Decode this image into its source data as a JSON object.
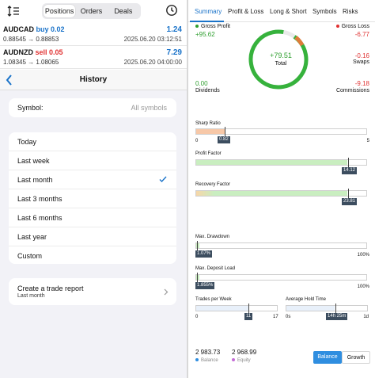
{
  "left": {
    "segments": [
      "Positions",
      "Orders",
      "Deals"
    ],
    "positions": [
      {
        "symbol": "AUDCAD",
        "side": "buy 0.02",
        "side_color": "#1a73c9",
        "prices": "0.88545 → 0.88853",
        "pl": "1.24",
        "time": "2025.06.20 03:12:51"
      },
      {
        "symbol": "AUDNZD",
        "side": "sell 0.05",
        "side_color": "#e03131",
        "prices": "1.08345 → 1.08065",
        "pl": "7.29",
        "time": "2025.06.20 04:00:00"
      }
    ],
    "history": {
      "title": "History",
      "symbol_label": "Symbol:",
      "symbol_value": "All symbols",
      "periods": [
        "Today",
        "Last week",
        "Last month",
        "Last 3 months",
        "Last 6 months",
        "Last year",
        "Custom"
      ],
      "selected_period": "Last month",
      "report_label": "Create a trade report",
      "report_sub": "Last month"
    }
  },
  "right": {
    "tabs": [
      "Summary",
      "Profit & Loss",
      "Long & Short",
      "Symbols",
      "Risks"
    ],
    "active_tab": "Summary",
    "gross_profit_label": "Gross Profit",
    "gross_profit": "+95.62",
    "gross_loss_label": "Gross Loss",
    "gross_loss": "-6.77",
    "swaps": "-0.16",
    "swaps_label": "Swaps",
    "dividends": "0.00",
    "dividends_label": "Dividends",
    "commissions": "-9.18",
    "commissions_label": "Commissions",
    "total": "+79.51",
    "total_label": "Total",
    "metrics": {
      "sharp_ratio": {
        "label": "Sharp Ratio",
        "value": "0.82",
        "fraction": 0.164,
        "min": "0",
        "max": "5"
      },
      "profit_factor": {
        "label": "Profit Factor",
        "value": "14.12",
        "fraction": 1.0
      },
      "recovery_factor": {
        "label": "Recovery Factor",
        "value": "23.81",
        "fraction": 1.0
      },
      "max_drawdown": {
        "label": "Max. Drawdown",
        "value": "1.07%",
        "fraction": 0.0107,
        "min": "0",
        "max": "100%"
      },
      "max_deposit_load": {
        "label": "Max. Deposit Load",
        "value": "1.855%",
        "fraction": 0.01855,
        "min": "0",
        "max": "100%"
      },
      "trades_per_week": {
        "label": "Trades per Week",
        "value": "11",
        "fraction": 0.647,
        "min": "0",
        "max": "17"
      },
      "avg_hold_time": {
        "label": "Average Hold Time",
        "value": "14h 25m",
        "fraction": 0.6,
        "min": "0s",
        "max": "1d"
      }
    },
    "footer": {
      "balance_value": "2 983.73",
      "balance_label": "Balance",
      "equity_value": "2 968.99",
      "equity_label": "Equity",
      "btn_balance": "Balance",
      "btn_growth": "Growth"
    },
    "colors": {
      "accent": "#1a73c9",
      "profit": "#2e9e2e",
      "loss": "#e03131",
      "ring": "#36b23c",
      "bar_green": "#c9eec0",
      "bar_orange": "#f7c8a8"
    }
  }
}
